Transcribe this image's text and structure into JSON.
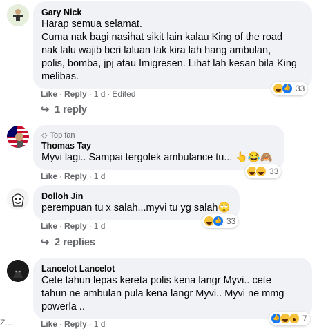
{
  "comments": [
    {
      "author": "Gary Nick",
      "lines": [
        "Harap semua selamat.",
        "Cuma nak bagi nasihat sikit lain kalau King of the road",
        "nak lalu wajib beri laluan tak kira lah hang ambulan,",
        "polis, bomba, jpj atau Imigresen. Lihat lah kesan bila King",
        "melibas."
      ],
      "like": "Like",
      "reply": "Reply",
      "time": "1 d",
      "edited": "Edited",
      "reaction_count": "33",
      "replies_label": "1 reply"
    },
    {
      "badge": "Top fan",
      "author": "Thomas Tay",
      "lines": [
        "Myvi lagi.. Sampai tergolek ambulance tu... 👆😂🙈"
      ],
      "like": "Like",
      "reply": "Reply",
      "time": "1 d",
      "reaction_count": "33"
    },
    {
      "author": "Dolloh Jin",
      "lines": [
        "perempuan tu x salah...myvi tu yg salah🙄"
      ],
      "like": "Like",
      "reply": "Reply",
      "time": "1 d",
      "reaction_count": "33",
      "replies_label": "2 replies"
    },
    {
      "author": "Lancelot Lancelot",
      "lines": [
        "Cete tahun lepas kereta polis kena langr Myvi.. cete",
        "tahun ne ambulan pula kena langr Myvi.. Myvi ne mmg",
        "powerla .."
      ],
      "like": "Like",
      "reply": "Reply",
      "time": "1 d",
      "reaction_count": "7"
    }
  ],
  "edge_text": "Z..."
}
